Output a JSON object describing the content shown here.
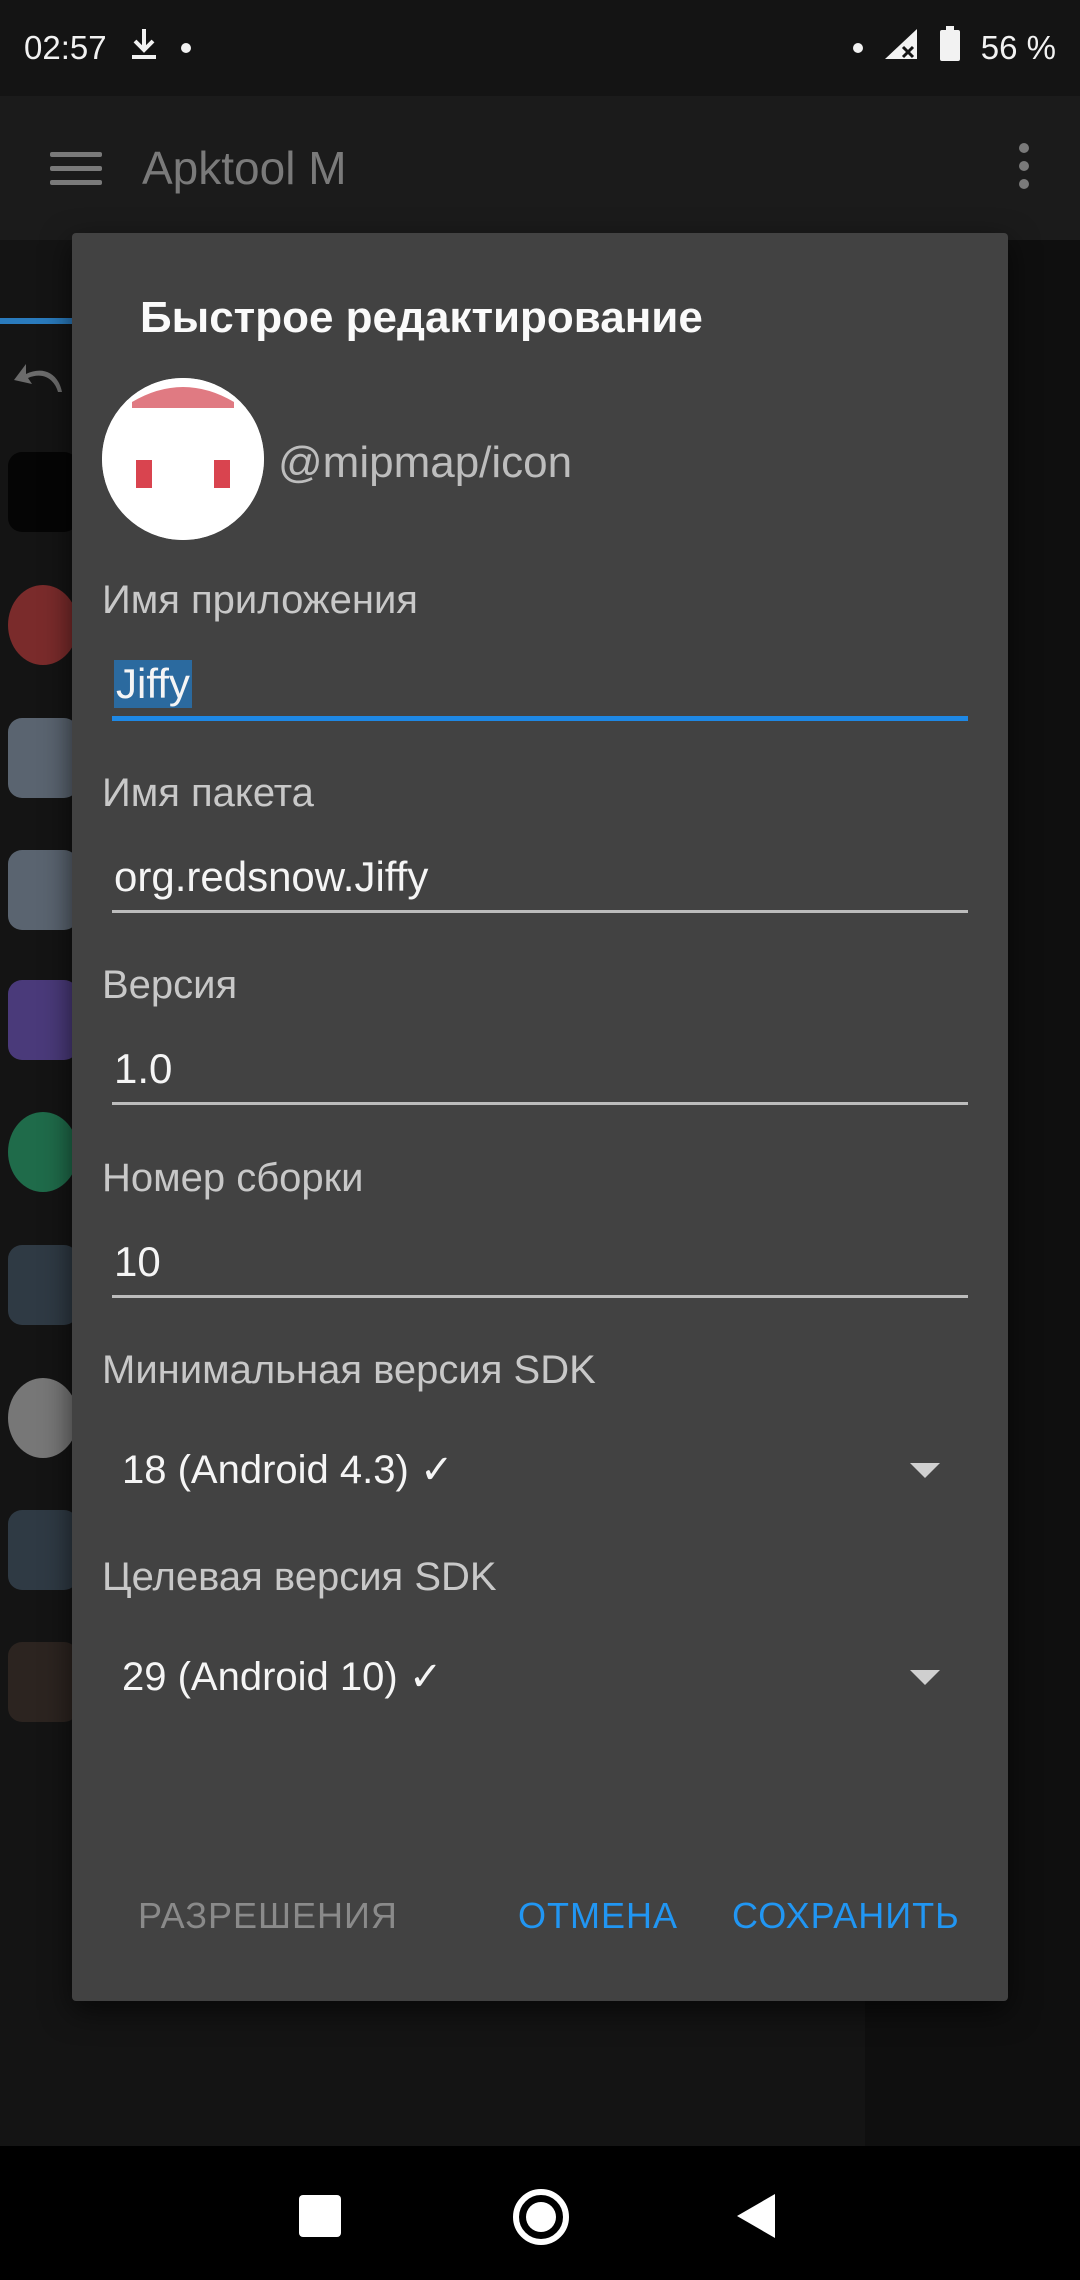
{
  "status": {
    "time": "02:57",
    "battery": "56 %",
    "icons": [
      "download-icon",
      "dot-icon",
      "signal-icon",
      "battery-icon"
    ]
  },
  "appbar": {
    "title": "Apktool M"
  },
  "dialog": {
    "title": "Быстрое редактирование",
    "icon_resource": "@mipmap/icon",
    "app_name_label": "Имя приложения",
    "app_name_value": "Jiffy",
    "package_label": "Имя пакета",
    "package_value": "org.redsnow.Jiffy",
    "version_label": "Версия",
    "version_value": "1.0",
    "build_label": "Номер сборки",
    "build_value": "10",
    "min_sdk_label": "Минимальная версия SDK",
    "min_sdk_value": "18 (Android 4.3) ✓",
    "target_sdk_label": "Целевая версия SDK",
    "target_sdk_value": "29 (Android 10) ✓",
    "btn_permissions": "РАЗРЕШЕНИЯ",
    "btn_cancel": "ОТМЕНА",
    "btn_save": "СОХРАНИТЬ"
  },
  "colors": {
    "accent": "#2196f3",
    "dialog_bg": "#424242",
    "selection": "#2b6a9f"
  }
}
